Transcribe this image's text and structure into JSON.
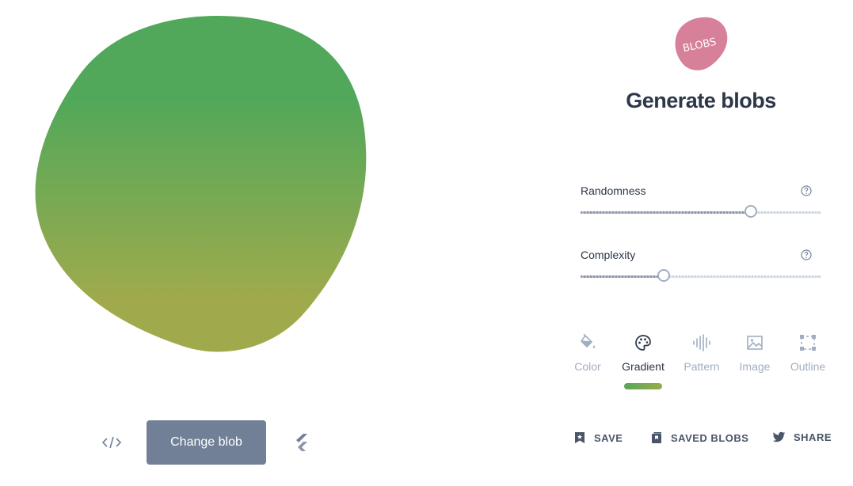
{
  "blob": {
    "gradient_top": "#52a85a",
    "gradient_bottom": "#a0aa4c"
  },
  "controls": {
    "change_blob_label": "Change blob",
    "code_icon": "code-icon",
    "flutter_icon": "flutter-icon"
  },
  "header": {
    "logo_text": "BLOBS",
    "logo_color": "#d6809a",
    "title": "Generate blobs"
  },
  "sliders": [
    {
      "label": "Randomness",
      "value_fraction": 0.71
    },
    {
      "label": "Complexity",
      "value_fraction": 0.35
    }
  ],
  "tabs": [
    {
      "label": "Color",
      "icon": "paint-bucket-icon",
      "active": false
    },
    {
      "label": "Gradient",
      "icon": "palette-icon",
      "active": true
    },
    {
      "label": "Pattern",
      "icon": "sound-wave-icon",
      "active": false
    },
    {
      "label": "Image",
      "icon": "image-icon",
      "active": false
    },
    {
      "label": "Outline",
      "icon": "outline-square-icon",
      "active": false
    }
  ],
  "actions": {
    "save": "SAVE",
    "saved_blobs": "SAVED BLOBS",
    "share": "SHARE"
  },
  "colors": {
    "accent_gray": "#718096",
    "text_dark": "#2d3748",
    "text_muted": "#a0aec0"
  }
}
